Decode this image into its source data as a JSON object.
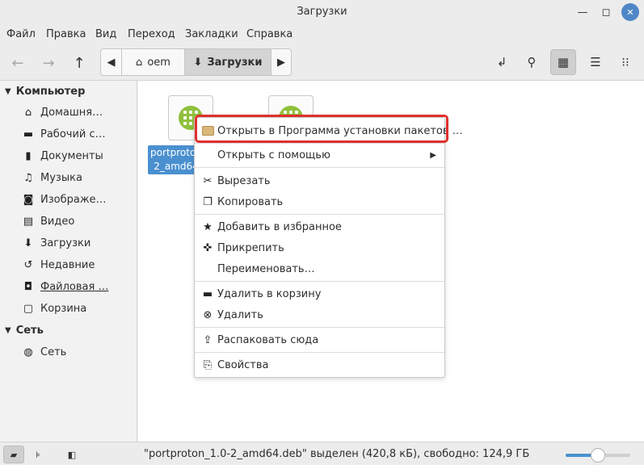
{
  "window": {
    "title": "Загрузки"
  },
  "menubar": [
    "Файл",
    "Правка",
    "Вид",
    "Переход",
    "Закладки",
    "Справка"
  ],
  "path": {
    "home": "oem",
    "current": "Загрузки"
  },
  "sidebar": {
    "sections": [
      {
        "title": "Компьютер",
        "items": [
          {
            "label": "Домашня…",
            "icon": "home-icon"
          },
          {
            "label": "Рабочий с…",
            "icon": "desktop-icon"
          },
          {
            "label": "Документы",
            "icon": "document-icon"
          },
          {
            "label": "Музыка",
            "icon": "music-icon"
          },
          {
            "label": "Изображе…",
            "icon": "camera-icon"
          },
          {
            "label": "Видео",
            "icon": "film-icon"
          },
          {
            "label": "Загрузки",
            "icon": "download-icon"
          },
          {
            "label": "Недавние",
            "icon": "history-icon"
          },
          {
            "label": "Файловая …",
            "icon": "drive-icon"
          },
          {
            "label": "Корзина",
            "icon": "trash-icon"
          }
        ]
      },
      {
        "title": "Сеть",
        "items": [
          {
            "label": "Сеть",
            "icon": "globe-icon"
          }
        ]
      }
    ]
  },
  "files": [
    {
      "label_line1": "portproton",
      "label_line2": "2_amd64",
      "selected": true
    }
  ],
  "context_menu": {
    "items": [
      {
        "label": "Открыть в Программа установки пакетов …",
        "icon": "package-icon",
        "highlighted": true
      },
      {
        "label": "Открыть с помощью",
        "submenu": true
      },
      {
        "label": "Вырезать",
        "icon": "scissors-icon"
      },
      {
        "label": "Копировать",
        "icon": "copy-icon"
      },
      {
        "label": "Добавить в избранное",
        "icon": "star-icon"
      },
      {
        "label": "Прикрепить",
        "icon": "pin-icon"
      },
      {
        "label": "Переименовать…"
      },
      {
        "label": "Удалить в корзину",
        "icon": "trash-icon"
      },
      {
        "label": "Удалить",
        "icon": "delete-icon"
      },
      {
        "label": "Распаковать сюда",
        "icon": "extract-icon"
      },
      {
        "label": "Свойства",
        "icon": "properties-icon"
      }
    ]
  },
  "statusbar": {
    "text": "\"portproton_1.0-2_amd64.deb\" выделен (420,8 кБ), свободно: 124,9 ГБ",
    "zoom_level": 0.5
  },
  "colors": {
    "accent": "#4a90d0",
    "highlight_box": "#e0302e",
    "close_button": "#4f87c6",
    "app_icon": "#8fc03c"
  }
}
